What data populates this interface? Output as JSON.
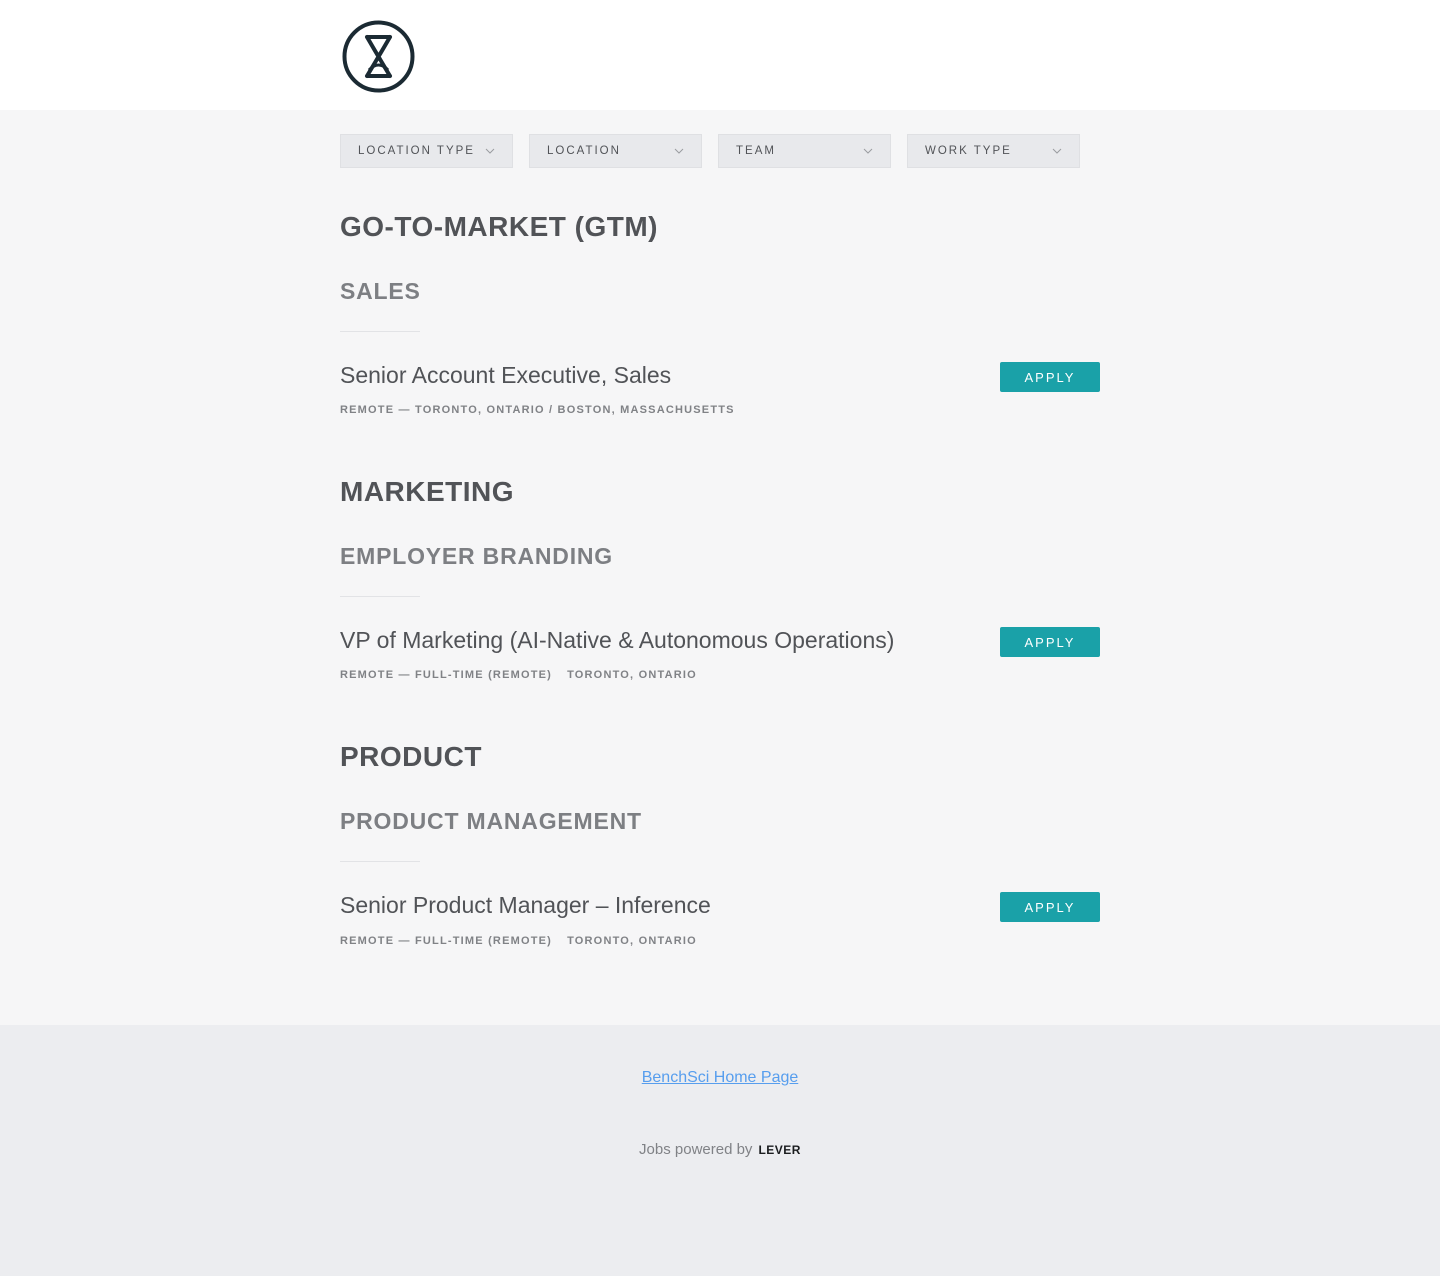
{
  "header": {
    "logo_icon": "benchsci-logo-icon"
  },
  "filters": [
    {
      "label": "LOCATION TYPE",
      "icon": "chevron-down-icon"
    },
    {
      "label": "LOCATION",
      "icon": "chevron-down-icon"
    },
    {
      "label": "TEAM",
      "icon": "chevron-down-icon"
    },
    {
      "label": "WORK TYPE",
      "icon": "chevron-down-icon"
    }
  ],
  "groups": [
    {
      "team": "GO-TO-MARKET (GTM)",
      "subteam": "SALES",
      "posting": {
        "title": "Senior Account Executive, Sales",
        "categories": [
          "REMOTE — TORONTO, ONTARIO / BOSTON, MASSACHUSETTS"
        ],
        "apply_label": "APPLY"
      }
    },
    {
      "team": "MARKETING",
      "subteam": "EMPLOYER BRANDING",
      "posting": {
        "title": "VP of Marketing (AI-Native & Autonomous Operations)",
        "categories": [
          "REMOTE — FULL-TIME (REMOTE)",
          "TORONTO, ONTARIO"
        ],
        "apply_label": "APPLY"
      }
    },
    {
      "team": "PRODUCT",
      "subteam": "PRODUCT MANAGEMENT",
      "posting": {
        "title": "Senior Product Manager – Inference",
        "categories": [
          "REMOTE — FULL-TIME (REMOTE)",
          "TORONTO, ONTARIO"
        ],
        "apply_label": "APPLY"
      }
    }
  ],
  "footer": {
    "home_link": "BenchSci Home Page",
    "powered_by": "Jobs powered by",
    "lever": "LEVER"
  },
  "colors": {
    "accent": "#1aa1a8",
    "link": "#579eee",
    "text": "#515357"
  }
}
